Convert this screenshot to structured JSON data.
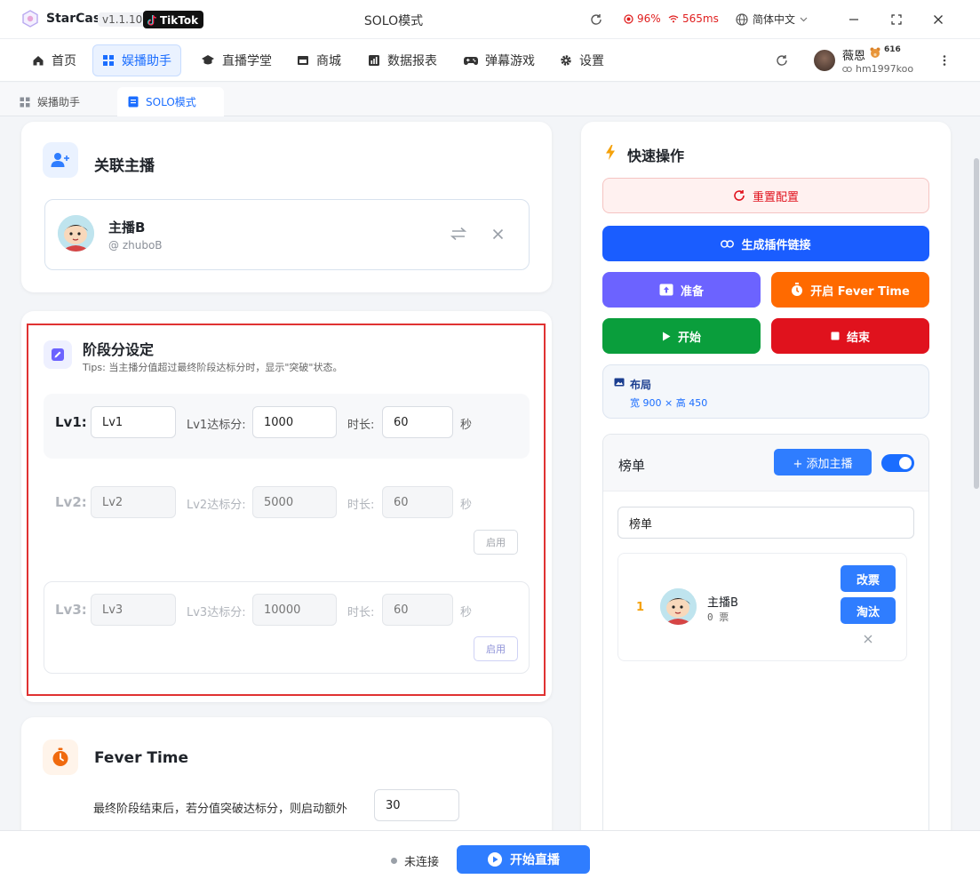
{
  "titlebar": {
    "app_name": "StarCast",
    "version": "v1.1.10",
    "platform_badge": "TikTok",
    "window_title": "SOLO模式",
    "cpu": "96%",
    "latency": "565ms",
    "language": "简体中文"
  },
  "nav": {
    "items": [
      {
        "label": "首页",
        "icon": "home-icon"
      },
      {
        "label": "娱播助手",
        "icon": "grid-icon"
      },
      {
        "label": "直播学堂",
        "icon": "graduation-cap-icon"
      },
      {
        "label": "商城",
        "icon": "store-icon"
      },
      {
        "label": "数据报表",
        "icon": "chart-icon"
      },
      {
        "label": "弹幕游戏",
        "icon": "gamepad-icon"
      },
      {
        "label": "设置",
        "icon": "gear-icon"
      }
    ],
    "active_index": 1
  },
  "user": {
    "name": "薇恩",
    "level": "616",
    "handle": "hm1997koo"
  },
  "tabs": [
    {
      "label": "娱播助手",
      "active": false
    },
    {
      "label": "SOLO模式",
      "active": true
    }
  ],
  "linked_streamer": {
    "title": "关联主播",
    "name": "主播B",
    "handle": "@ zhuboB"
  },
  "stage_settings": {
    "title": "阶段分设定",
    "tips": "Tips: 当主播分值超过最终阶段达标分时，显示\"突破\"状态。",
    "duration_label": "时长:",
    "seconds_unit": "秒",
    "enable_label": "启用",
    "levels": [
      {
        "label": "Lv1:",
        "name": "Lv1",
        "target_label": "Lv1达标分:",
        "target": "1000",
        "duration": "60",
        "enabled": true
      },
      {
        "label": "Lv2:",
        "name": "Lv2",
        "target_label": "Lv2达标分:",
        "target": "5000",
        "duration": "60",
        "enabled": false
      },
      {
        "label": "Lv3:",
        "name": "Lv3",
        "target_label": "Lv3达标分:",
        "target": "10000",
        "duration": "60",
        "enabled": false
      }
    ]
  },
  "fever": {
    "title": "Fever Time",
    "description": "最终阶段结束后，若分值突破达标分，则启动额外",
    "value": "30"
  },
  "quick_actions": {
    "title": "快速操作",
    "reset": "重置配置",
    "generate_link": "生成插件链接",
    "prepare": "准备",
    "fever_start": "开启 Fever Time",
    "start": "开始",
    "end": "结束",
    "layout_title": "布局",
    "layout_size": "宽 900 × 高 450"
  },
  "ranking": {
    "title": "榜单",
    "add_button": "+ 添加主播",
    "name_input": "榜单",
    "toggle_on": true,
    "entries": [
      {
        "rank": "1",
        "name": "主播B",
        "votes": "0 票",
        "edit_label": "改票",
        "eliminate_label": "淘汰"
      }
    ]
  },
  "bottom": {
    "status": "未连接",
    "start_live": "开始直播"
  },
  "colors": {
    "accent": "#1a6dff",
    "purple": "#6c63ff",
    "orange": "#ff6a00",
    "green": "#0a9e3c",
    "red": "#e0121d"
  }
}
